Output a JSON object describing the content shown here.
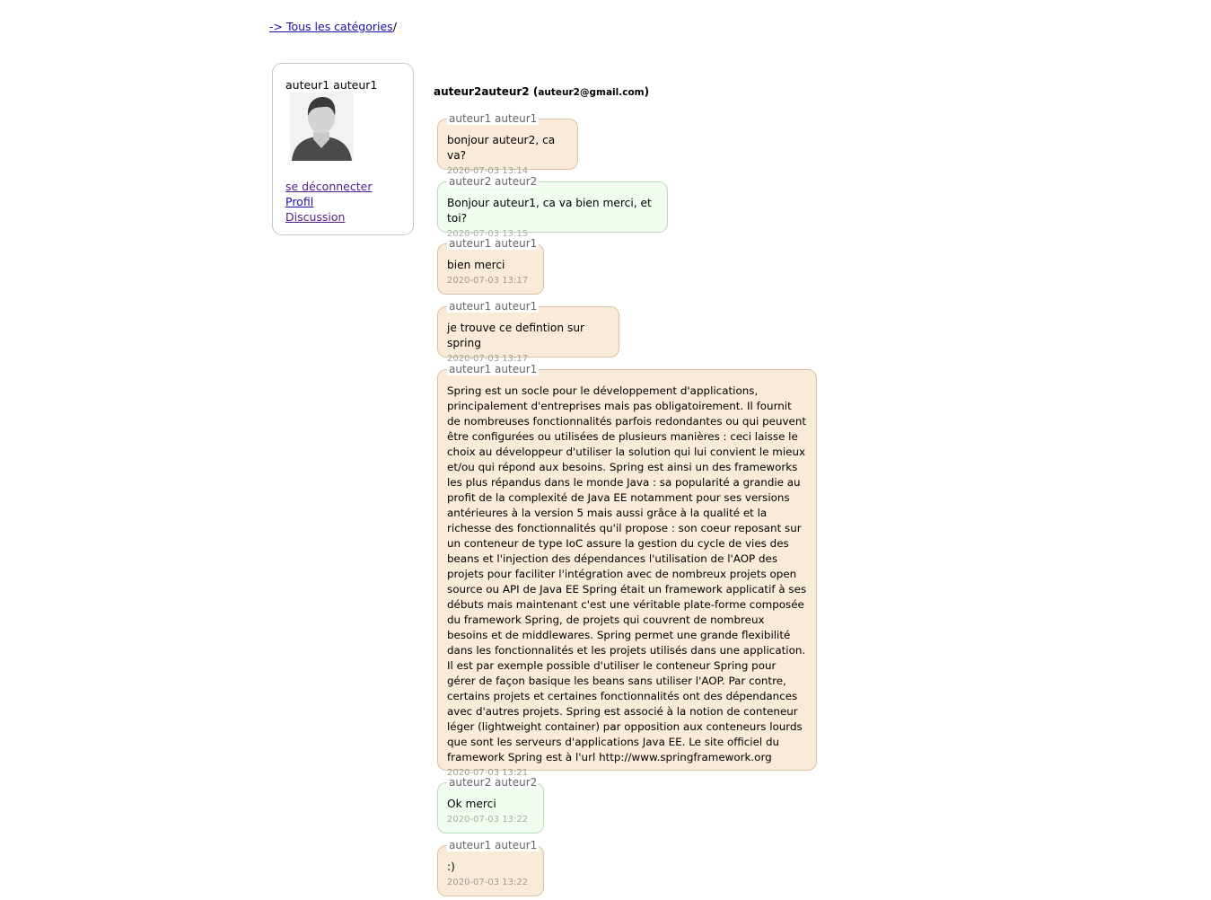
{
  "breadcrumb": {
    "link_label": "-> Tous les catégories",
    "separator": "/"
  },
  "user": {
    "name": "auteur1 auteur1",
    "avatar_icon": "person-avatar-icon",
    "links": {
      "logout": "se déconnecter",
      "profile": "Profil",
      "discussion": "Discussion"
    }
  },
  "conversation": {
    "contact_name": "auteur2auteur2",
    "contact_email_open": "(",
    "contact_email": "auteur2@gmail.com",
    "contact_email_close": ")"
  },
  "colors": {
    "mine": "#faead8",
    "theirs": "#f0fdf0"
  },
  "messages": [
    {
      "author": "auteur1 auteur1",
      "text": "bonjour auteur2, ca va?",
      "time": "2020-07-03 13:14"
    },
    {
      "author": "auteur2 auteur2",
      "text": "Bonjour auteur1, ca va bien merci, et toi?",
      "time": "2020-07-03 13:15"
    },
    {
      "author": "auteur1 auteur1",
      "text": "bien merci",
      "time": "2020-07-03 13:17"
    },
    {
      "author": "auteur1 auteur1",
      "text": "je trouve ce defintion sur spring",
      "time": "2020-07-03 13:17"
    },
    {
      "author": "auteur1 auteur1",
      "text": "Spring est un socle pour le développement d'applications, principalement d'entreprises mais pas obligatoirement. Il fournit de nombreuses fonctionnalités parfois redondantes ou qui peuvent être configurées ou utilisées de plusieurs manières : ceci laisse le choix au développeur d'utiliser la solution qui lui convient le mieux et/ou qui répond aux besoins. Spring est ainsi un des frameworks les plus répandus dans le monde Java : sa popularité a grandie au profit de la complexité de Java EE notamment pour ses versions antérieures à la version 5 mais aussi grâce à la qualité et la richesse des fonctionnalités qu'il propose : son coeur reposant sur un conteneur de type IoC assure la gestion du cycle de vies des beans et l'injection des dépendances l'utilisation de l'AOP des projets pour faciliter l'intégration avec de nombreux projets open source ou API de Java EE Spring était un framework applicatif à ses débuts mais maintenant c'est une véritable plate-forme composée du framework Spring, de projets qui couvrent de nombreux besoins et de middlewares. Spring permet une grande flexibilité dans les fonctionnalités et les projets utilisés dans une application. Il est par exemple possible d'utiliser le conteneur Spring pour gérer de façon basique les beans sans utiliser l'AOP. Par contre, certains projets et certaines fonctionnalités ont des dépendances avec d'autres projets. Spring est associé à la notion de conteneur léger (lightweight container) par opposition aux conteneurs lourds que sont les serveurs d'applications Java EE. Le site officiel du framework Spring est à l'url http://www.springframework.org",
      "time": "2020-07-03 13:21"
    },
    {
      "author": "auteur2 auteur2",
      "text": "Ok merci",
      "time": "2020-07-03 13:22"
    },
    {
      "author": "auteur1 auteur1",
      "text": ":)",
      "time": "2020-07-03 13:22"
    }
  ]
}
